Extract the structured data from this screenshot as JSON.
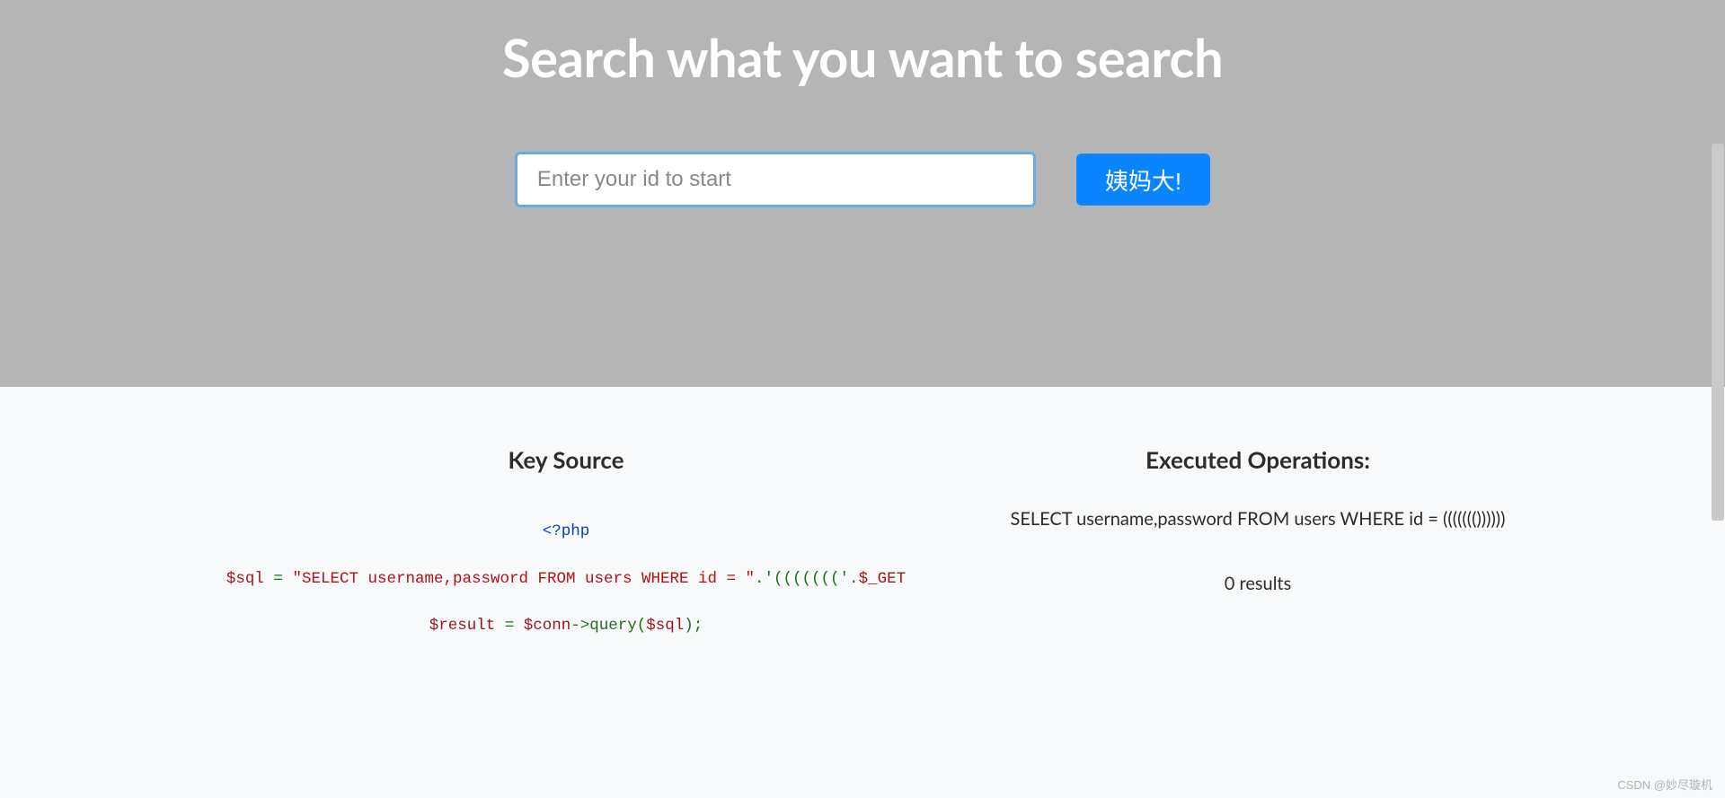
{
  "hero": {
    "title": "Search what you want to search",
    "search_placeholder": "Enter your id to start",
    "search_value": "",
    "submit_label": "姨妈大!"
  },
  "key_source": {
    "title": "Key Source",
    "code": {
      "line1_php_open": "<?php",
      "line2_var": "$sql",
      "line2_eq": " = ",
      "line2_str": "\"SELECT username,password FROM users WHERE id = \"",
      "line2_concat": ".'((((((('.",
      "line2_get": "$_GET",
      "line3_var": "$result",
      "line3_eq": " = ",
      "line3_conn": "$conn",
      "line3_arrow": "->",
      "line3_func": "query",
      "line3_paren_open": "(",
      "line3_arg": "$sql",
      "line3_paren_close": ");"
    }
  },
  "executed": {
    "title": "Executed Operations:",
    "query": "SELECT username,password FROM users WHERE id = ((((((())))))",
    "results": "0 results"
  },
  "watermark": "CSDN @妙尽璇机"
}
